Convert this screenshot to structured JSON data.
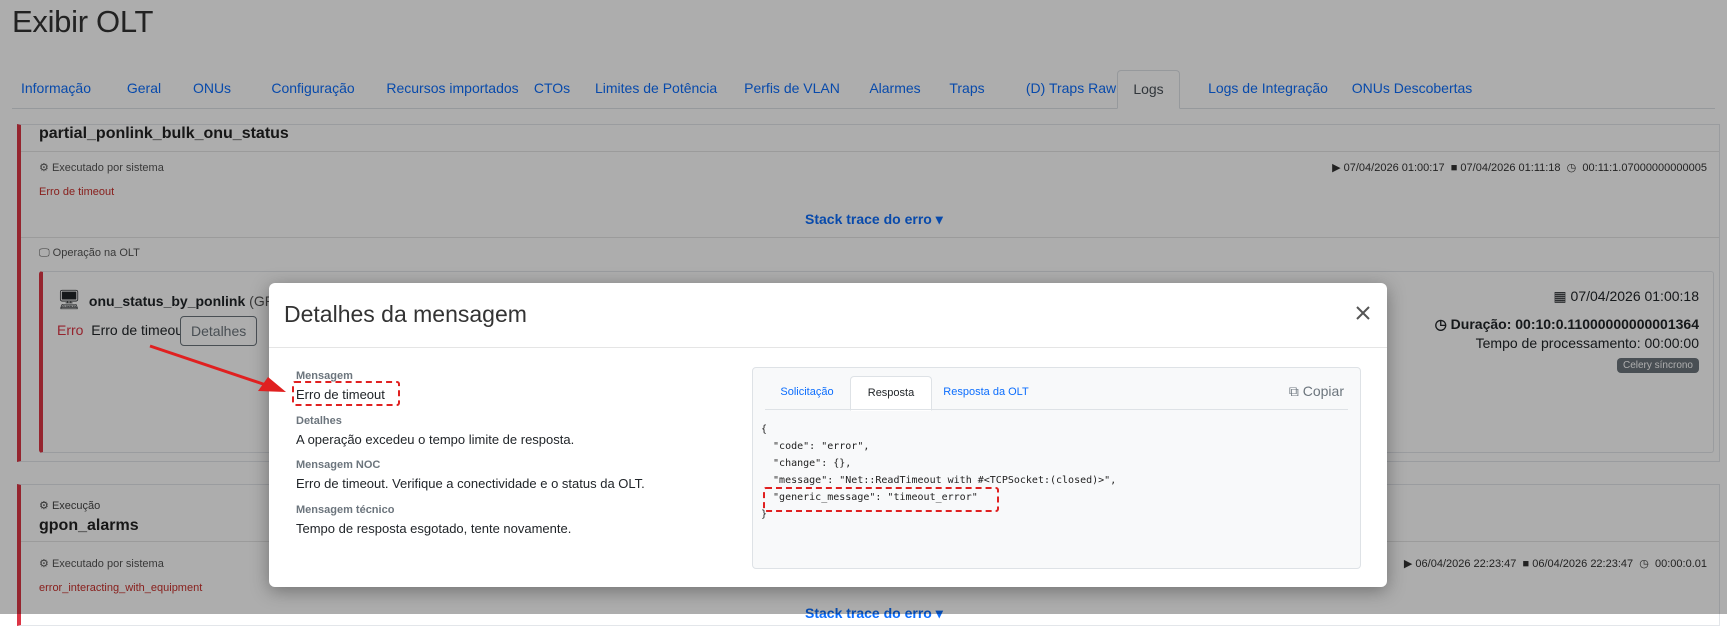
{
  "page": {
    "title_light": "Exibir",
    "title_bold": "OLT"
  },
  "tabs": [
    {
      "label": "Informação"
    },
    {
      "label": "Geral"
    },
    {
      "label": "ONUs"
    },
    {
      "label": "Configuração"
    },
    {
      "label": "Recursos importados"
    },
    {
      "label": "CTOs"
    },
    {
      "label": "Limites de Potência"
    },
    {
      "label": "Perfis de VLAN"
    },
    {
      "label": "Alarmes"
    },
    {
      "label": "Traps"
    },
    {
      "label": "(D) Traps Raw"
    },
    {
      "label": "Logs",
      "active": true
    },
    {
      "label": "Logs de Integração"
    },
    {
      "label": "ONUs Descobertas"
    }
  ],
  "log1": {
    "name": "partial_ponlink_bulk_onu_status",
    "executed_by": "Executado por sistema",
    "error": "Erro de timeout",
    "start": "07/04/2026 01:00:17",
    "end": "07/04/2026 01:11:18",
    "duration": "00:11:1.07000000000005",
    "stack_trace": "Stack trace do erro",
    "operation_header": "Operação na OLT",
    "op": {
      "name": "onu_status_by_ponlink",
      "name_suffix": "(GP",
      "status": "Erro",
      "message": "Erro de timeout",
      "details_button": "Detalhes",
      "date": "07/04/2026 01:00:18",
      "duration_label": "Duração:",
      "duration_value": "00:10:0.11000000000001364",
      "processing_time": "Tempo de processamento: 00:00:00",
      "badge": "Celery síncrono"
    }
  },
  "log2": {
    "header": "Execução",
    "name": "gpon_alarms",
    "executed_by": "Executado por sistema",
    "error": "error_interacting_with_equipment",
    "start": "06/04/2026 22:23:47",
    "end": "06/04/2026 22:23:47",
    "duration": "00:00:0.01",
    "stack_trace": "Stack trace do erro"
  },
  "modal": {
    "title": "Detalhes da mensagem",
    "fields": [
      {
        "label": "Mensagem",
        "value": "Erro de timeout"
      },
      {
        "label": "Detalhes",
        "value": "A operação excedeu o tempo limite de resposta."
      },
      {
        "label": "Mensagem NOC",
        "value": "Erro de timeout. Verifique a conectividade e o status da OLT."
      },
      {
        "label": "Mensagem técnico",
        "value": "Tempo de resposta esgotado, tente novamente."
      }
    ],
    "code_tabs": [
      {
        "label": "Solicitação"
      },
      {
        "label": "Resposta",
        "active": true
      },
      {
        "label": "Resposta da OLT"
      }
    ],
    "copy_label": "Copiar",
    "code_lines": [
      "{",
      "  \"code\": \"error\",",
      "  \"change\": {},",
      "  \"message\": \"Net::ReadTimeout with #<TCPSocket:(closed)>\",",
      "  \"generic_message\": \"timeout_error\"",
      "}"
    ]
  },
  "colors": {
    "accent": "#0d6efd",
    "danger": "#dc3545",
    "annotation": "#e02020"
  }
}
